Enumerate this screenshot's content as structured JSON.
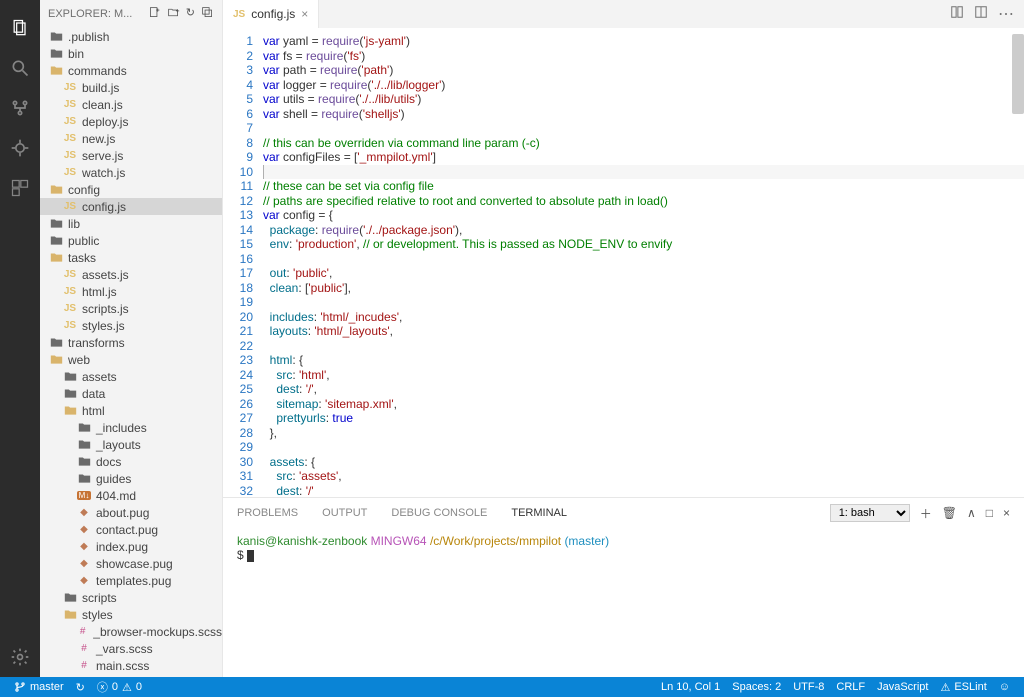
{
  "sidebar": {
    "title": "EXPLORER: M...",
    "tree": [
      {
        "depth": 0,
        "type": "folder",
        "open": false,
        "label": ".publish"
      },
      {
        "depth": 0,
        "type": "folder",
        "open": false,
        "label": "bin"
      },
      {
        "depth": 0,
        "type": "folder",
        "open": true,
        "label": "commands"
      },
      {
        "depth": 1,
        "type": "js",
        "label": "build.js"
      },
      {
        "depth": 1,
        "type": "js",
        "label": "clean.js"
      },
      {
        "depth": 1,
        "type": "js",
        "label": "deploy.js"
      },
      {
        "depth": 1,
        "type": "js",
        "label": "new.js"
      },
      {
        "depth": 1,
        "type": "js",
        "label": "serve.js"
      },
      {
        "depth": 1,
        "type": "js",
        "label": "watch.js"
      },
      {
        "depth": 0,
        "type": "folder",
        "open": true,
        "label": "config"
      },
      {
        "depth": 1,
        "type": "js",
        "label": "config.js",
        "selected": true
      },
      {
        "depth": 0,
        "type": "folder",
        "open": false,
        "label": "lib"
      },
      {
        "depth": 0,
        "type": "folder",
        "open": false,
        "label": "public"
      },
      {
        "depth": 0,
        "type": "folder",
        "open": true,
        "label": "tasks"
      },
      {
        "depth": 1,
        "type": "js",
        "label": "assets.js"
      },
      {
        "depth": 1,
        "type": "js",
        "label": "html.js"
      },
      {
        "depth": 1,
        "type": "js",
        "label": "scripts.js"
      },
      {
        "depth": 1,
        "type": "js",
        "label": "styles.js"
      },
      {
        "depth": 0,
        "type": "folder",
        "open": false,
        "label": "transforms"
      },
      {
        "depth": 0,
        "type": "folder",
        "open": true,
        "label": "web"
      },
      {
        "depth": 1,
        "type": "folder",
        "open": false,
        "label": "assets"
      },
      {
        "depth": 1,
        "type": "folder",
        "open": false,
        "label": "data"
      },
      {
        "depth": 1,
        "type": "folder",
        "open": true,
        "label": "html"
      },
      {
        "depth": 2,
        "type": "folder",
        "open": false,
        "label": "_includes"
      },
      {
        "depth": 2,
        "type": "folder",
        "open": false,
        "label": "_layouts"
      },
      {
        "depth": 2,
        "type": "folder",
        "open": false,
        "label": "docs"
      },
      {
        "depth": 2,
        "type": "folder",
        "open": false,
        "label": "guides"
      },
      {
        "depth": 2,
        "type": "md",
        "label": "404.md"
      },
      {
        "depth": 2,
        "type": "pug",
        "label": "about.pug"
      },
      {
        "depth": 2,
        "type": "pug",
        "label": "contact.pug"
      },
      {
        "depth": 2,
        "type": "pug",
        "label": "index.pug"
      },
      {
        "depth": 2,
        "type": "pug",
        "label": "showcase.pug"
      },
      {
        "depth": 2,
        "type": "pug",
        "label": "templates.pug"
      },
      {
        "depth": 1,
        "type": "folder",
        "open": false,
        "label": "scripts"
      },
      {
        "depth": 1,
        "type": "folder",
        "open": true,
        "label": "styles"
      },
      {
        "depth": 2,
        "type": "scss",
        "label": "_browser-mockups.scss"
      },
      {
        "depth": 2,
        "type": "scss",
        "label": "_vars.scss"
      },
      {
        "depth": 2,
        "type": "scss",
        "label": "main.scss"
      }
    ]
  },
  "tab": {
    "icon": "JS",
    "label": "config.js"
  },
  "code_lines": [
    [
      [
        "kw",
        "var"
      ],
      [
        "",
        " yaml = "
      ],
      [
        "fn",
        "require"
      ],
      [
        "",
        "("
      ],
      [
        "str",
        "'js-yaml'"
      ],
      [
        "",
        ")"
      ]
    ],
    [
      [
        "kw",
        "var"
      ],
      [
        "",
        " fs = "
      ],
      [
        "fn",
        "require"
      ],
      [
        "",
        "("
      ],
      [
        "str",
        "'fs'"
      ],
      [
        "",
        ")"
      ]
    ],
    [
      [
        "kw",
        "var"
      ],
      [
        "",
        " path = "
      ],
      [
        "fn",
        "require"
      ],
      [
        "",
        "("
      ],
      [
        "str",
        "'path'"
      ],
      [
        "",
        ")"
      ]
    ],
    [
      [
        "kw",
        "var"
      ],
      [
        "",
        " logger = "
      ],
      [
        "fn",
        "require"
      ],
      [
        "",
        "("
      ],
      [
        "str",
        "'./../lib/logger'"
      ],
      [
        "",
        ")"
      ]
    ],
    [
      [
        "kw",
        "var"
      ],
      [
        "",
        " utils = "
      ],
      [
        "fn",
        "require"
      ],
      [
        "",
        "("
      ],
      [
        "str",
        "'./../lib/utils'"
      ],
      [
        "",
        ")"
      ]
    ],
    [
      [
        "kw",
        "var"
      ],
      [
        "",
        " shell = "
      ],
      [
        "fn",
        "require"
      ],
      [
        "",
        "("
      ],
      [
        "str",
        "'shelljs'"
      ],
      [
        "",
        ")"
      ]
    ],
    [],
    [
      [
        "com",
        "// this can be overriden via command line param (-c)"
      ]
    ],
    [
      [
        "kw",
        "var"
      ],
      [
        "",
        " configFiles = ["
      ],
      [
        "str",
        "'_mmpilot.yml'"
      ],
      [
        "",
        "]"
      ]
    ],
    [
      [
        "hl",
        ""
      ]
    ],
    [
      [
        "com",
        "// these can be set via config file"
      ]
    ],
    [
      [
        "com",
        "// paths are specified relative to root and converted to absolute path in load()"
      ]
    ],
    [
      [
        "kw",
        "var"
      ],
      [
        "",
        " config = {"
      ]
    ],
    [
      [
        "",
        "  "
      ],
      [
        "prop",
        "package"
      ],
      [
        "",
        ": "
      ],
      [
        "fn",
        "require"
      ],
      [
        "",
        "("
      ],
      [
        "str",
        "'./../package.json'"
      ],
      [
        "",
        ")"
      ],
      [
        "",
        ","
      ]
    ],
    [
      [
        "",
        "  "
      ],
      [
        "prop",
        "env"
      ],
      [
        "",
        ": "
      ],
      [
        "str",
        "'production'"
      ],
      [
        "",
        ", "
      ],
      [
        "com",
        "// or development. This is passed as NODE_ENV to envify"
      ]
    ],
    [],
    [
      [
        "",
        "  "
      ],
      [
        "prop",
        "out"
      ],
      [
        "",
        ": "
      ],
      [
        "str",
        "'public'"
      ],
      [
        "",
        ","
      ]
    ],
    [
      [
        "",
        "  "
      ],
      [
        "prop",
        "clean"
      ],
      [
        "",
        ": ["
      ],
      [
        "str",
        "'public'"
      ],
      [
        "",
        "]"
      ],
      [
        "",
        ","
      ]
    ],
    [],
    [
      [
        "",
        "  "
      ],
      [
        "prop",
        "includes"
      ],
      [
        "",
        ": "
      ],
      [
        "str",
        "'html/_incudes'"
      ],
      [
        "",
        ","
      ]
    ],
    [
      [
        "",
        "  "
      ],
      [
        "prop",
        "layouts"
      ],
      [
        "",
        ": "
      ],
      [
        "str",
        "'html/_layouts'"
      ],
      [
        "",
        ","
      ]
    ],
    [],
    [
      [
        "",
        "  "
      ],
      [
        "prop",
        "html"
      ],
      [
        "",
        ": {"
      ]
    ],
    [
      [
        "",
        "    "
      ],
      [
        "prop",
        "src"
      ],
      [
        "",
        ": "
      ],
      [
        "str",
        "'html'"
      ],
      [
        "",
        ","
      ]
    ],
    [
      [
        "",
        "    "
      ],
      [
        "prop",
        "dest"
      ],
      [
        "",
        ": "
      ],
      [
        "str",
        "'/'"
      ],
      [
        "",
        ","
      ]
    ],
    [
      [
        "",
        "    "
      ],
      [
        "prop",
        "sitemap"
      ],
      [
        "",
        ": "
      ],
      [
        "str",
        "'sitemap.xml'"
      ],
      [
        "",
        ","
      ]
    ],
    [
      [
        "",
        "    "
      ],
      [
        "prop",
        "prettyurls"
      ],
      [
        "",
        ": "
      ],
      [
        "lit",
        "true"
      ]
    ],
    [
      [
        "",
        "  },"
      ]
    ],
    [],
    [
      [
        "",
        "  "
      ],
      [
        "prop",
        "assets"
      ],
      [
        "",
        ": {"
      ]
    ],
    [
      [
        "",
        "    "
      ],
      [
        "prop",
        "src"
      ],
      [
        "",
        ": "
      ],
      [
        "str",
        "'assets'"
      ],
      [
        "",
        ","
      ]
    ],
    [
      [
        "",
        "    "
      ],
      [
        "prop",
        "dest"
      ],
      [
        "",
        ": "
      ],
      [
        "str",
        "'/'"
      ]
    ]
  ],
  "panel": {
    "tabs": [
      "PROBLEMS",
      "OUTPUT",
      "DEBUG CONSOLE",
      "TERMINAL"
    ],
    "active": "TERMINAL",
    "select": "1: bash",
    "prompt_user": "kanis@kanishk-zenbook",
    "prompt_sys": "MINGW64",
    "prompt_path": "/c/Work/projects/mmpilot",
    "prompt_branch": "(master)",
    "prompt_sym": "$"
  },
  "status": {
    "branch": "master",
    "sync": "↻",
    "errors": "0",
    "warnings": "0",
    "lncol": "Ln 10, Col 1",
    "spaces": "Spaces: 2",
    "enc": "UTF-8",
    "eol": "CRLF",
    "lang": "JavaScript",
    "eslint": "ESLint",
    "smile": "☺"
  }
}
